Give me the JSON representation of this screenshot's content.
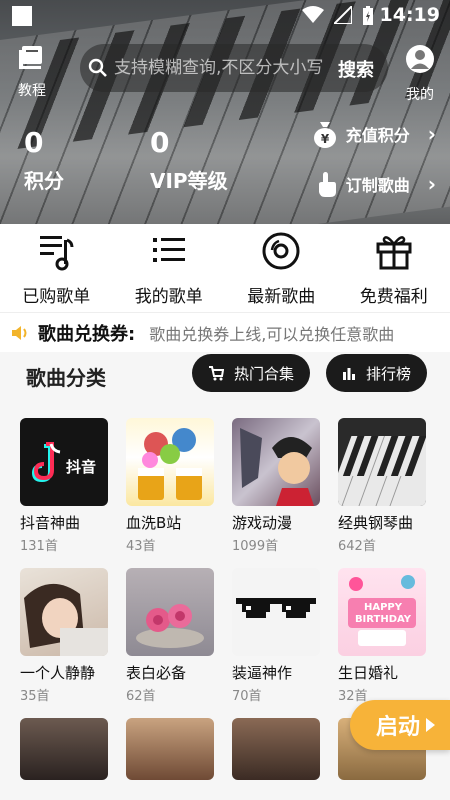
{
  "status": {
    "time": "14:19"
  },
  "header": {
    "tutorial_label": "教程",
    "mine_label": "我的",
    "search_placeholder": "支持模糊查询,不区分大小写",
    "search_button": "搜索"
  },
  "stats": [
    {
      "value": "0",
      "label": "积分"
    },
    {
      "value": "0",
      "label": "VIP等级"
    }
  ],
  "side_links": [
    {
      "label": "充值积分",
      "icon": "money-bag-icon"
    },
    {
      "label": "订制歌曲",
      "icon": "hand-pointer-icon"
    }
  ],
  "quick_nav": [
    {
      "label": "已购歌单",
      "icon": "music-list-icon"
    },
    {
      "label": "我的歌单",
      "icon": "list-icon"
    },
    {
      "label": "最新歌曲",
      "icon": "disc-icon"
    },
    {
      "label": "免费福利",
      "icon": "gift-icon"
    }
  ],
  "notice": {
    "title": "歌曲兑换券:",
    "text": "歌曲兑换券上线,可以兑换任意歌曲"
  },
  "category": {
    "title": "歌曲分类",
    "hot_label": "热门合集",
    "rank_label": "排行榜"
  },
  "cards": [
    {
      "name": "抖音神曲",
      "count": "131首",
      "thumb_text": "抖音"
    },
    {
      "name": "血洗B站",
      "count": "43首"
    },
    {
      "name": "游戏动漫",
      "count": "1099首"
    },
    {
      "name": "经典钢琴曲",
      "count": "642首"
    },
    {
      "name": "一个人静静",
      "count": "35首"
    },
    {
      "name": "表白必备",
      "count": "62首"
    },
    {
      "name": "装逼神作",
      "count": "70首"
    },
    {
      "name": "生日婚礼",
      "count": "32首",
      "thumb_text": "HAPPY BIRTHDAY"
    }
  ],
  "start_button": "启动",
  "colors": {
    "accent": "#f7b339",
    "pill_bg": "#1b1b1b"
  }
}
